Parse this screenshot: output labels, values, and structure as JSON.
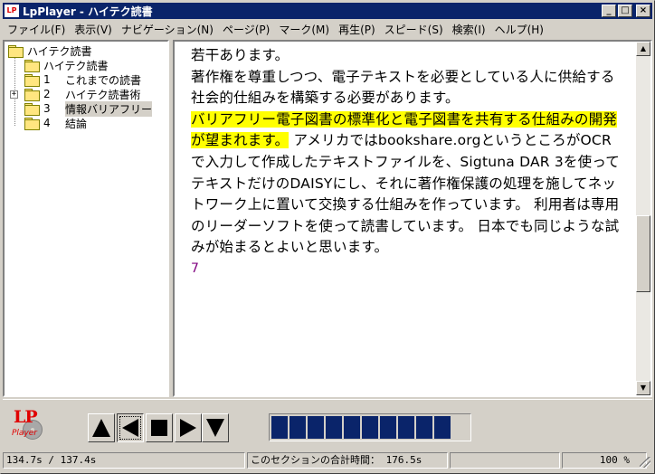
{
  "window": {
    "title": "LpPlayer - ハイテク読書",
    "app_icon_text": "LP",
    "minimize_glyph": "_",
    "maximize_glyph": "□",
    "close_glyph": "×"
  },
  "menu": [
    {
      "label": "ファイル(F)"
    },
    {
      "label": "表示(V)"
    },
    {
      "label": "ナビゲーション(N)"
    },
    {
      "label": "ページ(P)"
    },
    {
      "label": "マーク(M)"
    },
    {
      "label": "再生(P)"
    },
    {
      "label": "スピード(S)"
    },
    {
      "label": "検索(I)"
    },
    {
      "label": "ヘルプ(H)"
    }
  ],
  "tree": {
    "root": "ハイテク読書",
    "items": [
      {
        "num": "",
        "label": "ハイテク読書"
      },
      {
        "num": "1",
        "label": "これまでの読書"
      },
      {
        "num": "2",
        "label": "ハイテク読書術",
        "expander": "+"
      },
      {
        "num": "3",
        "label": "情報バリアフリー",
        "selected": true
      },
      {
        "num": "4",
        "label": "結論"
      }
    ]
  },
  "content": {
    "line_before": "若干あります。",
    "para_before": "著作権を尊重しつつ、電子テキストを必要としている人に供給する社会的仕組みを構築する必要があります。",
    "highlight": "バリアフリー電子図書の標準化と電子図書を共有する仕組みの開発が望まれます。",
    "para_after": "アメリカではbookshare.orgというところがOCRで入力して作成したテキストファイルを、Sigtuna DAR 3を使ってテキストだけのDAISYにし、それに著作権保護の処理を施してネットワーク上に置いて交換する仕組みを作っています。 利用者は専用のリーダーソフトを使って読書しています。 日本でも同じような試みが始まるとよいと思います。",
    "page_number": "7"
  },
  "scrollbar": {
    "up_glyph": "▲",
    "down_glyph": "▼"
  },
  "logo": {
    "lp": "LP",
    "player": "Player"
  },
  "progress": {
    "filled_fraction": 0.9,
    "segments_filled": 10
  },
  "status": {
    "time": "134.7s / 137.4s",
    "section_total": "このセクションの合計時間： 176.5s",
    "zoom": "100 %"
  }
}
